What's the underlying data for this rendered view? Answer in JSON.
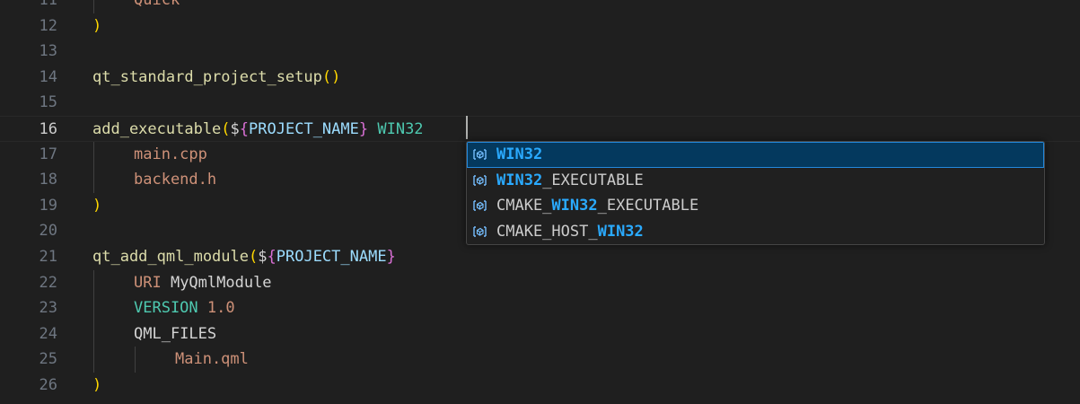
{
  "editor": {
    "lines": [
      {
        "num": "11",
        "tokens": [
          {
            "t": "Quick",
            "c": "arg"
          }
        ],
        "indent": 1
      },
      {
        "num": "12",
        "tokens": [
          {
            "t": ")",
            "c": "paren"
          }
        ],
        "indent": 0
      },
      {
        "num": "13",
        "tokens": [],
        "indent": 0
      },
      {
        "num": "14",
        "tokens": [
          {
            "t": "qt_standard_project_setup",
            "c": "fn"
          },
          {
            "t": "()",
            "c": "paren"
          }
        ],
        "indent": 0
      },
      {
        "num": "15",
        "tokens": [],
        "indent": 0
      },
      {
        "num": "16",
        "tokens": [
          {
            "t": "add_executable",
            "c": "fn"
          },
          {
            "t": "(",
            "c": "paren"
          },
          {
            "t": "$",
            "c": "dollar"
          },
          {
            "t": "{",
            "c": "brace"
          },
          {
            "t": "PROJECT_NAME",
            "c": "var"
          },
          {
            "t": "}",
            "c": "brace"
          },
          {
            "t": " WIN32",
            "c": "kw"
          }
        ],
        "indent": 0,
        "current": true
      },
      {
        "num": "17",
        "tokens": [
          {
            "t": "main.cpp",
            "c": "arg"
          }
        ],
        "indent": 1
      },
      {
        "num": "18",
        "tokens": [
          {
            "t": "backend.h",
            "c": "arg"
          }
        ],
        "indent": 1
      },
      {
        "num": "19",
        "tokens": [
          {
            "t": ")",
            "c": "paren"
          }
        ],
        "indent": 0
      },
      {
        "num": "20",
        "tokens": [],
        "indent": 0
      },
      {
        "num": "21",
        "tokens": [
          {
            "t": "qt_add_qml_module",
            "c": "fn"
          },
          {
            "t": "(",
            "c": "paren"
          },
          {
            "t": "$",
            "c": "dollar"
          },
          {
            "t": "{",
            "c": "brace"
          },
          {
            "t": "PROJECT_NAME",
            "c": "var"
          },
          {
            "t": "}",
            "c": "brace"
          }
        ],
        "indent": 0
      },
      {
        "num": "22",
        "tokens": [
          {
            "t": "URI",
            "c": "arg"
          },
          {
            "t": " MyQmlModule",
            "c": "plain"
          }
        ],
        "indent": 1
      },
      {
        "num": "23",
        "tokens": [
          {
            "t": "VERSION",
            "c": "kw"
          },
          {
            "t": " 1.0",
            "c": "num"
          }
        ],
        "indent": 1
      },
      {
        "num": "24",
        "tokens": [
          {
            "t": "QML_FILES",
            "c": "plain"
          }
        ],
        "indent": 1
      },
      {
        "num": "25",
        "tokens": [
          {
            "t": "Main.qml",
            "c": "arg"
          }
        ],
        "indent": 2
      },
      {
        "num": "26",
        "tokens": [
          {
            "t": ")",
            "c": "paren"
          }
        ],
        "indent": 0
      }
    ]
  },
  "suggest": {
    "icon": "variable-icon",
    "items": [
      {
        "parts": [
          {
            "t": "WIN32",
            "hl": true
          }
        ],
        "selected": true
      },
      {
        "parts": [
          {
            "t": "WIN32",
            "hl": true
          },
          {
            "t": "_EXECUTABLE",
            "hl": false
          }
        ],
        "selected": false
      },
      {
        "parts": [
          {
            "t": "CMAKE_",
            "hl": false
          },
          {
            "t": "WIN32",
            "hl": true
          },
          {
            "t": "_EXECUTABLE",
            "hl": false
          }
        ],
        "selected": false
      },
      {
        "parts": [
          {
            "t": "CMAKE_HOST_",
            "hl": false
          },
          {
            "t": "WIN32",
            "hl": true
          }
        ],
        "selected": false
      }
    ]
  },
  "colors": {
    "background": "#1f1f1f",
    "selection": "#04395e",
    "match_highlight": "#2aaaff"
  }
}
